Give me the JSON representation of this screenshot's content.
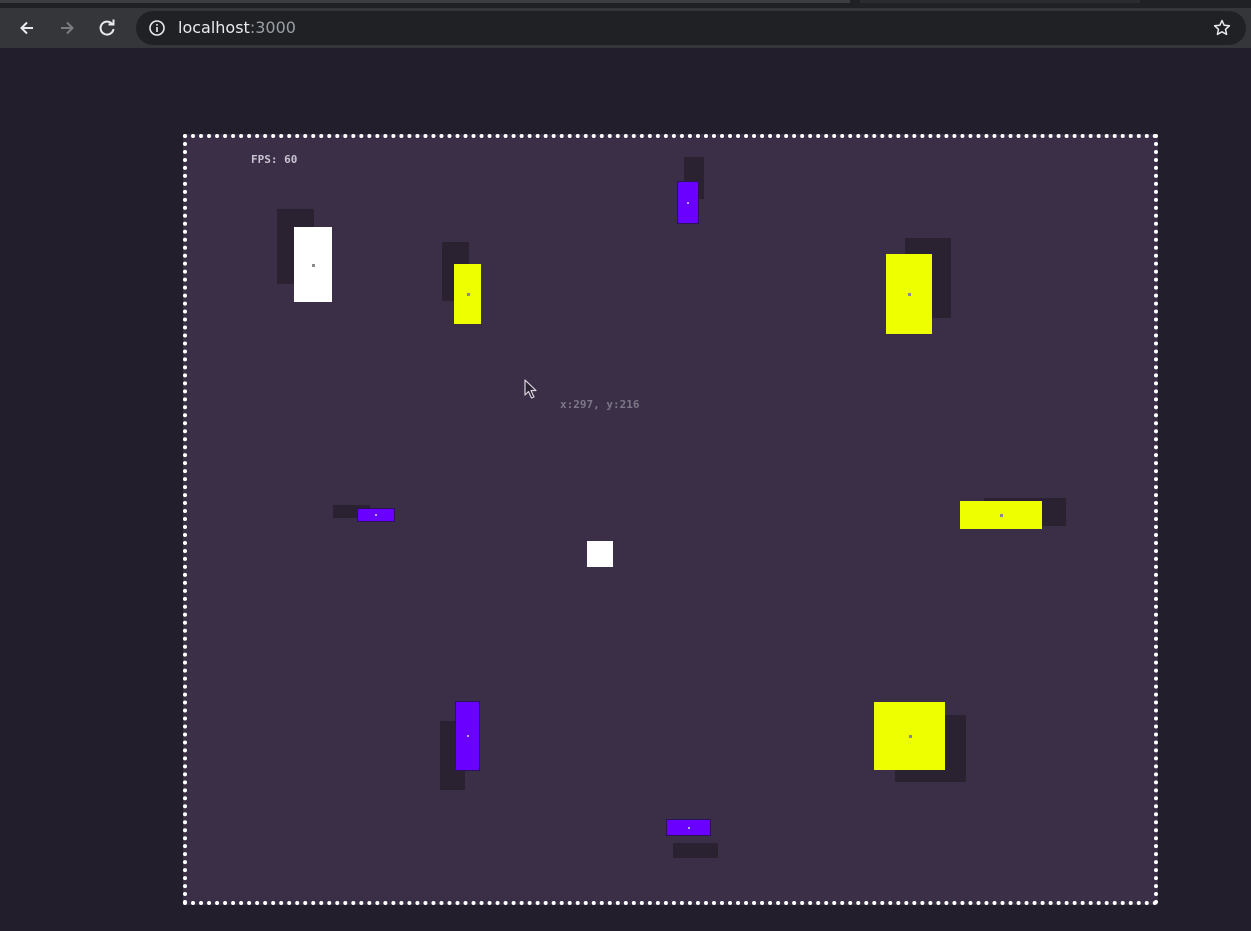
{
  "browser": {
    "url_host": "localhost",
    "url_port": ":3000",
    "icons": {
      "back": "arrow-left-icon",
      "forward": "arrow-right-icon",
      "reload": "reload-icon",
      "site_info": "info-icon",
      "bookmark": "star-icon"
    }
  },
  "game": {
    "fps_label": "FPS: 60",
    "cursor_readout": "x:297, y:216",
    "colors": {
      "background": "#221e2c",
      "arena": "#3a2f47",
      "border": "#ffffff",
      "shadow": "#2a2231",
      "yellow": "#eeff00",
      "purple": "#6a00ff",
      "white": "#ffffff"
    }
  }
}
